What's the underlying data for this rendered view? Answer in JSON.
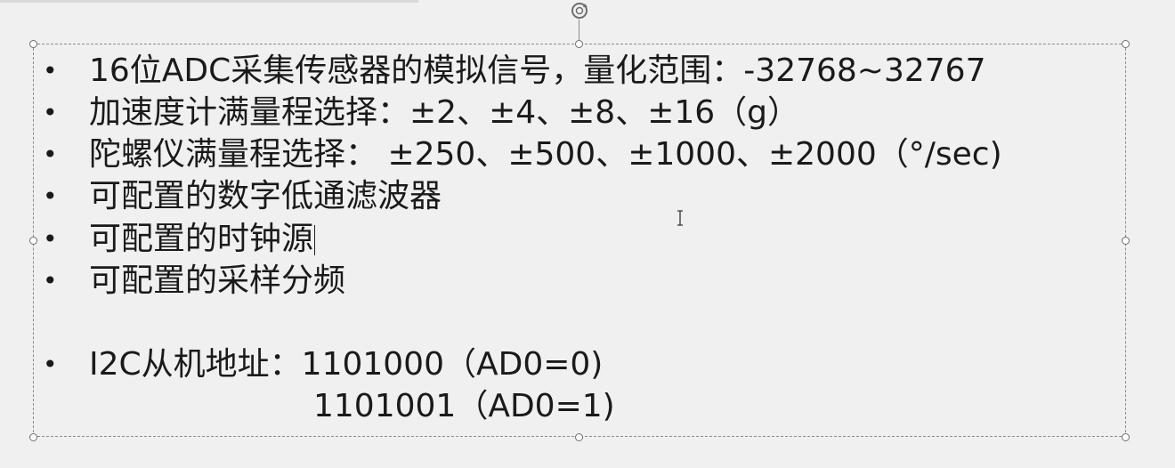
{
  "slide": {
    "bullets": [
      "16位ADC采集传感器的模拟信号，量化范围：-32768~32767",
      "加速度计满量程选择：±2、±4、±8、±16（g）",
      "陀螺仪满量程选择： ±250、±500、±1000、±2000（°/sec)",
      "可配置的数字低通滤波器",
      "可配置的时钟源",
      "可配置的采样分频"
    ],
    "i2c_label": "I2C从机地址：1101000（AD0=0)",
    "i2c_second": "1101001（AD0=1)"
  },
  "icons": {
    "rotate": "rotate-icon",
    "cursor": "text-cursor-icon"
  }
}
